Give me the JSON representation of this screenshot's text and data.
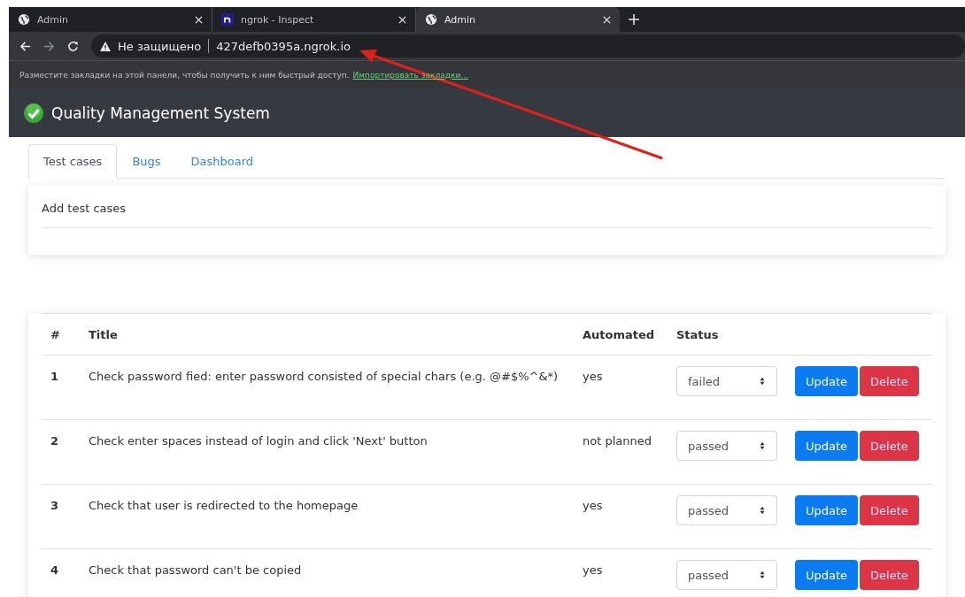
{
  "browser_tabs": [
    {
      "title": "Admin",
      "kind": "globe",
      "selected": false
    },
    {
      "title": "ngrok - Inspect",
      "kind": "ngrok",
      "selected": false
    },
    {
      "title": "Admin",
      "kind": "globe",
      "selected": true
    }
  ],
  "address_bar": {
    "security": "Не защищено",
    "url": "427defb0395a.ngrok.io"
  },
  "bookmarks_bar": {
    "message": "Разместите закладки на этой панели, чтобы получить к ним быстрый доступ.",
    "link": "Импортировать закладки..."
  },
  "app": {
    "title": "Quality Management System"
  },
  "tabs": [
    {
      "label": "Test cases",
      "selected": true
    },
    {
      "label": "Bugs",
      "selected": false
    },
    {
      "label": "Dashboard",
      "selected": false
    }
  ],
  "add_card": {
    "title": "Add test cases"
  },
  "table": {
    "columns": [
      "#",
      "Title",
      "Automated",
      "Status"
    ],
    "rows": [
      {
        "number": "1",
        "title": "Check password fied: enter password consisted of special chars (e.g. @#$%^&*)",
        "automated": "yes",
        "status": "failed",
        "update": "Update",
        "delete": "Delete"
      },
      {
        "number": "2",
        "title": "Check enter spaces instead of login and click 'Next' button",
        "automated": "not planned",
        "status": "passed",
        "update": "Update",
        "delete": "Delete"
      },
      {
        "number": "3",
        "title": "Check that user is redirected to the homepage",
        "automated": "yes",
        "status": "passed",
        "update": "Update",
        "delete": "Delete"
      },
      {
        "number": "4",
        "title": "Check that password can't be copied",
        "automated": "yes",
        "status": "passed",
        "update": "Update",
        "delete": "Delete"
      }
    ]
  }
}
